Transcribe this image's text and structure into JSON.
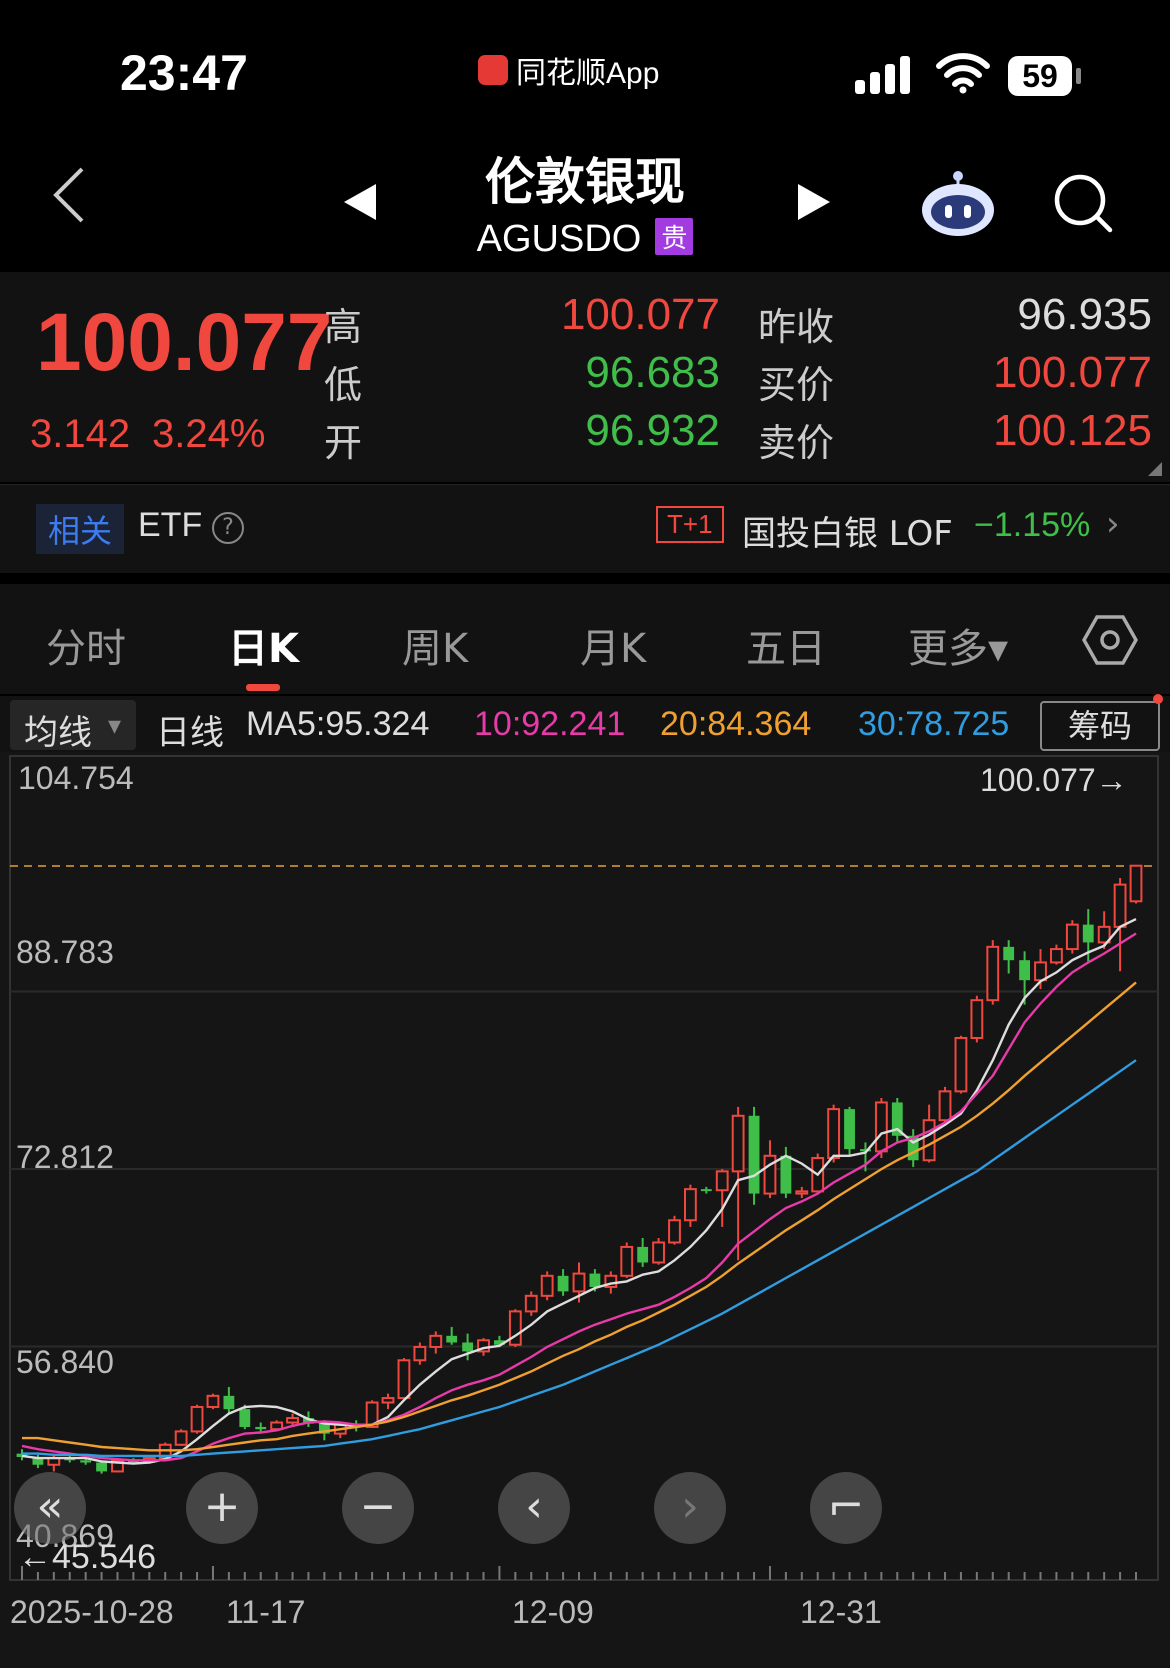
{
  "status_bar": {
    "time": "23:47",
    "app": "同花顺App",
    "battery": "59",
    "colors": {
      "logo": "#e53935"
    }
  },
  "nav": {
    "title": "伦敦银现",
    "code": "AGUSDO",
    "tag": "贵",
    "icons": [
      "back-chevron-icon",
      "prev-triangle-icon",
      "next-triangle-icon",
      "robot-assistant-icon",
      "search-icon"
    ]
  },
  "quote": {
    "price": "100.077",
    "change": "3.142",
    "change_pct": "3.24%",
    "high_label": "高",
    "high": "100.077",
    "low_label": "低",
    "low": "96.683",
    "open_label": "开",
    "open": "96.932",
    "prev_close_label": "昨收",
    "prev_close": "96.935",
    "bid_label": "买价",
    "bid": "100.077",
    "ask_label": "卖价",
    "ask": "100.125",
    "colors": {
      "up": "#f0483e",
      "down": "#3fbf4a"
    }
  },
  "related": {
    "tag": "相关",
    "label": "ETF",
    "help": "?",
    "t1": "T+1",
    "name": "国投白银 LOF",
    "pct": "−1.15%",
    "arrow": "›"
  },
  "tabs": [
    {
      "label": "分时",
      "active": false
    },
    {
      "label": "日K",
      "active": true
    },
    {
      "label": "周K",
      "active": false
    },
    {
      "label": "月K",
      "active": false
    },
    {
      "label": "五日",
      "active": false
    },
    {
      "label": "更多▾",
      "active": false
    }
  ],
  "ma_bar": {
    "selector": "均线",
    "caret": "▾",
    "period": "日线",
    "ma5": "MA5:95.324",
    "ma10": "10:92.241",
    "ma20": "20:84.364",
    "ma30": "30:78.725",
    "chips_button": "筹码",
    "colors": {
      "ma5": "#dddddd",
      "ma10": "#e83aa8",
      "ma20": "#f0a030",
      "ma30": "#2f9de0"
    }
  },
  "controls": [
    "«",
    "+",
    "−",
    "‹",
    "›",
    "⌐"
  ],
  "chart_data": {
    "type": "candlestick",
    "y_ticks": [
      "104.754",
      "88.783",
      "72.812",
      "56.840",
      "40.869"
    ],
    "ylim": [
      40.869,
      104.754
    ],
    "last_price_label": "100.077→",
    "last_price": 100.077,
    "low_marker_label": "←45.546",
    "low_marker": 45.546,
    "x_tick_labels": [
      "2025-10-28",
      "11-17",
      "12-09",
      "12-31"
    ],
    "x_tick_index": [
      0,
      12,
      30,
      47
    ],
    "candles": [
      [
        47.2,
        47.6,
        46.6,
        46.9
      ],
      [
        46.9,
        47.1,
        45.9,
        46.2
      ],
      [
        46.2,
        47.0,
        45.6,
        46.8
      ],
      [
        46.8,
        47.0,
        46.4,
        46.6
      ],
      [
        46.6,
        46.8,
        46.2,
        46.4
      ],
      [
        46.4,
        46.6,
        45.4,
        45.6
      ],
      [
        45.6,
        46.8,
        45.5,
        46.6
      ],
      [
        46.6,
        46.8,
        46.3,
        46.5
      ],
      [
        46.5,
        47.0,
        46.3,
        46.8
      ],
      [
        46.8,
        48.2,
        46.6,
        48.0
      ],
      [
        48.0,
        49.4,
        47.9,
        49.2
      ],
      [
        49.2,
        51.6,
        49.0,
        51.4
      ],
      [
        51.4,
        52.6,
        51.2,
        52.4
      ],
      [
        52.4,
        53.2,
        50.8,
        51.2
      ],
      [
        51.2,
        51.6,
        49.4,
        49.6
      ],
      [
        49.6,
        50.0,
        49.0,
        49.4
      ],
      [
        49.4,
        50.2,
        49.2,
        50.0
      ],
      [
        50.0,
        50.8,
        49.6,
        50.4
      ],
      [
        50.4,
        51.0,
        49.6,
        49.9
      ],
      [
        49.9,
        50.2,
        48.4,
        49.0
      ],
      [
        49.0,
        50.0,
        48.6,
        49.8
      ],
      [
        49.8,
        50.2,
        49.2,
        49.6
      ],
      [
        49.6,
        52.0,
        49.5,
        51.8
      ],
      [
        51.8,
        52.6,
        51.2,
        52.2
      ],
      [
        52.2,
        55.8,
        52.0,
        55.6
      ],
      [
        55.6,
        57.2,
        55.2,
        56.8
      ],
      [
        56.8,
        58.2,
        56.2,
        57.8
      ],
      [
        57.8,
        58.6,
        57.0,
        57.2
      ],
      [
        57.2,
        58.0,
        55.6,
        56.4
      ],
      [
        56.4,
        57.6,
        56.0,
        57.4
      ],
      [
        57.4,
        57.8,
        56.8,
        57.0
      ],
      [
        57.0,
        60.2,
        56.8,
        60.0
      ],
      [
        60.0,
        61.8,
        59.6,
        61.4
      ],
      [
        61.4,
        63.6,
        61.0,
        63.2
      ],
      [
        63.2,
        63.8,
        61.4,
        61.8
      ],
      [
        61.8,
        64.4,
        60.8,
        63.4
      ],
      [
        63.4,
        63.8,
        61.8,
        62.2
      ],
      [
        62.2,
        63.6,
        61.6,
        63.2
      ],
      [
        63.2,
        66.2,
        63.0,
        65.8
      ],
      [
        65.8,
        66.6,
        64.0,
        64.4
      ],
      [
        64.4,
        66.6,
        64.2,
        66.2
      ],
      [
        66.2,
        68.6,
        66.0,
        68.2
      ],
      [
        68.2,
        71.4,
        67.6,
        71.0
      ],
      [
        71.0,
        71.2,
        70.6,
        70.9
      ],
      [
        70.9,
        72.8,
        67.6,
        72.6
      ],
      [
        72.6,
        78.4,
        64.6,
        77.6
      ],
      [
        77.6,
        78.4,
        69.6,
        70.6
      ],
      [
        70.6,
        75.4,
        70.2,
        74.0
      ],
      [
        74.0,
        74.8,
        70.2,
        70.6
      ],
      [
        70.6,
        71.2,
        70.2,
        70.8
      ],
      [
        70.8,
        74.2,
        70.6,
        73.8
      ],
      [
        73.8,
        78.6,
        73.4,
        78.2
      ],
      [
        78.2,
        78.4,
        74.0,
        74.6
      ],
      [
        74.6,
        75.2,
        72.6,
        74.4
      ],
      [
        74.4,
        79.2,
        73.8,
        78.8
      ],
      [
        78.8,
        79.2,
        75.2,
        75.8
      ],
      [
        75.8,
        76.4,
        73.0,
        73.6
      ],
      [
        73.6,
        78.6,
        73.4,
        77.2
      ],
      [
        77.2,
        80.2,
        76.8,
        79.8
      ],
      [
        79.8,
        84.8,
        79.6,
        84.6
      ],
      [
        84.6,
        88.4,
        84.2,
        88.0
      ],
      [
        88.0,
        93.4,
        87.6,
        92.8
      ],
      [
        92.8,
        93.4,
        90.4,
        91.6
      ],
      [
        91.6,
        92.4,
        87.6,
        89.8
      ],
      [
        89.8,
        92.6,
        89.0,
        91.4
      ],
      [
        91.4,
        93.0,
        91.2,
        92.6
      ],
      [
        92.6,
        95.2,
        92.2,
        94.8
      ],
      [
        94.8,
        96.2,
        91.4,
        93.2
      ],
      [
        93.2,
        96.0,
        92.6,
        94.6
      ],
      [
        94.6,
        99.0,
        90.6,
        98.4
      ],
      [
        96.9,
        100.1,
        96.7,
        100.1
      ]
    ],
    "ma_series": [
      {
        "name": "MA5",
        "values": [
          47.0,
          46.8,
          46.8,
          46.8,
          46.8,
          46.5,
          46.4,
          46.3,
          46.4,
          46.7,
          47.4,
          48.5,
          49.7,
          50.8,
          51.4,
          51.5,
          51.4,
          51.0,
          50.3,
          49.9,
          49.8,
          49.7,
          49.8,
          50.5,
          52.0,
          53.4,
          54.6,
          55.7,
          56.2,
          56.7,
          56.9,
          57.8,
          58.8,
          60.0,
          60.7,
          61.4,
          62.1,
          62.5,
          62.7,
          63.3,
          63.6,
          64.6,
          65.8,
          67.3,
          69.2,
          71.8,
          72.2,
          73.2,
          74.0,
          73.3,
          72.3,
          74.0,
          74.0,
          74.3,
          76.0,
          76.4,
          75.2,
          75.9,
          76.8,
          77.8,
          79.9,
          82.6,
          85.8,
          88.2,
          89.7,
          90.5,
          91.6,
          92.3,
          92.9,
          94.6,
          95.3
        ]
      },
      {
        "name": "MA10",
        "values": [
          47.9,
          47.6,
          47.4,
          47.2,
          47.0,
          46.8,
          46.7,
          46.6,
          46.6,
          46.6,
          46.8,
          47.4,
          48.1,
          48.6,
          49.0,
          49.1,
          49.3,
          49.7,
          50.0,
          50.1,
          50.0,
          49.8,
          49.8,
          50.2,
          50.7,
          51.4,
          52.2,
          52.9,
          53.4,
          53.8,
          54.3,
          55.1,
          55.9,
          56.8,
          57.5,
          58.2,
          58.8,
          59.3,
          59.8,
          60.2,
          60.6,
          61.3,
          62.1,
          63.0,
          64.4,
          66.1,
          67.2,
          68.3,
          69.3,
          69.9,
          70.6,
          71.6,
          72.4,
          73.2,
          74.4,
          75.2,
          75.6,
          76.2,
          77.0,
          78.0,
          79.6,
          81.2,
          83.6,
          86.0,
          87.7,
          89.2,
          90.5,
          91.4,
          92.2,
          93.1,
          94.0
        ]
      },
      {
        "name": "MA20",
        "values": [
          48.6,
          48.6,
          48.4,
          48.2,
          48.0,
          47.8,
          47.7,
          47.6,
          47.5,
          47.5,
          47.5,
          47.6,
          47.8,
          48.0,
          48.2,
          48.4,
          48.5,
          48.8,
          49.0,
          49.2,
          49.4,
          49.6,
          49.8,
          50.1,
          50.5,
          51.0,
          51.5,
          52.0,
          52.4,
          52.9,
          53.4,
          54.0,
          54.6,
          55.3,
          56.0,
          56.6,
          57.3,
          57.9,
          58.6,
          59.2,
          59.9,
          60.6,
          61.4,
          62.2,
          63.2,
          64.3,
          65.3,
          66.3,
          67.3,
          68.2,
          69.1,
          70.1,
          71.0,
          71.9,
          72.8,
          73.6,
          74.3,
          75.0,
          75.8,
          76.6,
          77.6,
          78.7,
          79.9,
          81.2,
          82.4,
          83.6,
          84.8,
          86.0,
          87.2,
          88.4,
          89.6
        ]
      },
      {
        "name": "MA30",
        "values": [
          47.2,
          47.2,
          47.1,
          47.1,
          47.1,
          47.0,
          47.0,
          47.0,
          47.0,
          47.0,
          47.0,
          47.1,
          47.2,
          47.3,
          47.4,
          47.5,
          47.6,
          47.7,
          47.8,
          47.9,
          48.1,
          48.3,
          48.5,
          48.8,
          49.1,
          49.4,
          49.8,
          50.2,
          50.6,
          51.0,
          51.4,
          51.9,
          52.4,
          52.9,
          53.4,
          54.0,
          54.6,
          55.2,
          55.8,
          56.4,
          57.0,
          57.7,
          58.4,
          59.1,
          59.8,
          60.6,
          61.4,
          62.2,
          63.0,
          63.8,
          64.6,
          65.4,
          66.2,
          67.0,
          67.8,
          68.6,
          69.4,
          70.2,
          71.0,
          71.8,
          72.6,
          73.6,
          74.6,
          75.6,
          76.6,
          77.6,
          78.6,
          79.6,
          80.6,
          81.6,
          82.6
        ]
      }
    ],
    "colors": {
      "up": "#f0483e",
      "down": "#3fbf4a",
      "grid": "#2a2a2a",
      "last_line": "#e0a040"
    }
  }
}
